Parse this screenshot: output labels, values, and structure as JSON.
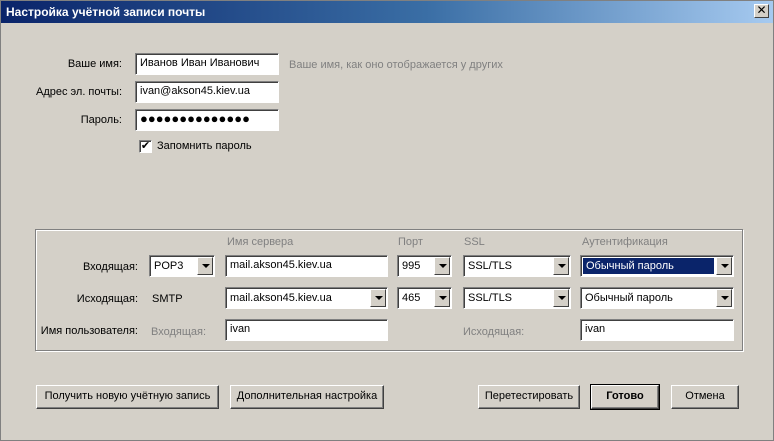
{
  "window": {
    "title": "Настройка учётной записи почты",
    "close": "✕"
  },
  "identity": {
    "name_label": "Ваше имя:",
    "name_value": "Иванов Иван Иванович",
    "name_hint": "Ваше имя, как оно отображается у других",
    "email_label": "Адрес эл. почты:",
    "email_value": "ivan@akson45.kiev.ua",
    "password_label": "Пароль:",
    "password_value": "●●●●●●●●●●●●●●",
    "remember_label": "Запомнить пароль",
    "remember_checked": "✔"
  },
  "servers": {
    "headers": {
      "server": "Имя сервера",
      "port": "Порт",
      "ssl": "SSL",
      "auth": "Аутентификация"
    },
    "incoming": {
      "label": "Входящая:",
      "protocol": "POP3",
      "server": "mail.akson45.kiev.ua",
      "port": "995",
      "ssl": "SSL/TLS",
      "auth": "Обычный пароль"
    },
    "outgoing": {
      "label": "Исходящая:",
      "protocol": "SMTP",
      "server": "mail.akson45.kiev.ua",
      "port": "465",
      "ssl": "SSL/TLS",
      "auth": "Обычный пароль"
    },
    "username": {
      "label": "Имя пользователя:",
      "incoming_label": "Входящая:",
      "incoming_value": "ivan",
      "outgoing_label": "Исходящая:",
      "outgoing_value": "ivan"
    }
  },
  "buttons": {
    "new_account": "Получить новую учётную запись",
    "advanced": "Дополнительная настройка",
    "retest": "Перетестировать",
    "done": "Готово",
    "cancel": "Отмена"
  }
}
